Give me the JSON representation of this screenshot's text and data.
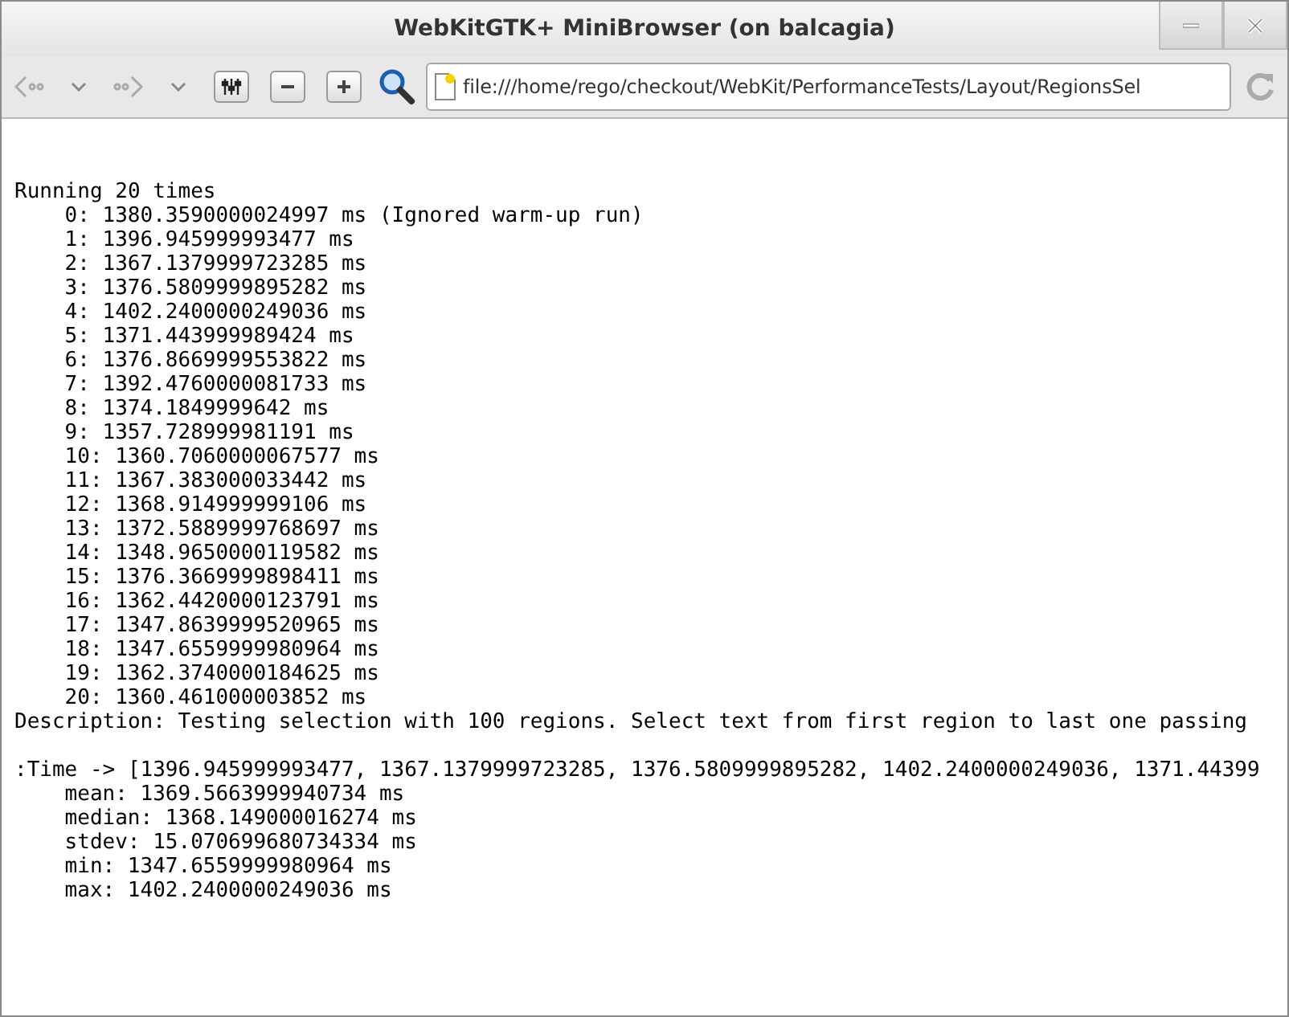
{
  "window": {
    "title": "WebKitGTK+ MiniBrowser (on balcagia)"
  },
  "toolbar": {
    "back_disabled": true,
    "forward_disabled": true,
    "url": "file:///home/rego/checkout/WebKit/PerformanceTests/Layout/RegionsSel"
  },
  "output": {
    "header": "Running 20 times",
    "runs": [
      "0: 1380.3590000024997 ms (Ignored warm-up run)",
      "1: 1396.945999993477 ms",
      "2: 1367.1379999723285 ms",
      "3: 1376.5809999895282 ms",
      "4: 1402.2400000249036 ms",
      "5: 1371.443999989424 ms",
      "6: 1376.8669999553822 ms",
      "7: 1392.4760000081733 ms",
      "8: 1374.1849999642 ms",
      "9: 1357.728999981191 ms",
      "10: 1360.7060000067577 ms",
      "11: 1367.383000033442 ms",
      "12: 1368.914999999106 ms",
      "13: 1372.5889999768697 ms",
      "14: 1348.9650000119582 ms",
      "15: 1376.3669999898411 ms",
      "16: 1362.4420000123791 ms",
      "17: 1347.8639999520965 ms",
      "18: 1347.6559999980964 ms",
      "19: 1362.3740000184625 ms",
      "20: 1360.461000003852 ms"
    ],
    "description": "Description: Testing selection with 100 regions. Select text from first region to last one passing",
    "time_line": ":Time -> [1396.945999993477, 1367.1379999723285, 1376.5809999895282, 1402.2400000249036, 1371.44399",
    "stats": [
      "mean: 1369.5663999940734 ms",
      "median: 1368.149000016274 ms",
      "stdev: 15.070699680734334 ms",
      "min: 1347.6559999980964 ms",
      "max: 1402.2400000249036 ms"
    ]
  }
}
